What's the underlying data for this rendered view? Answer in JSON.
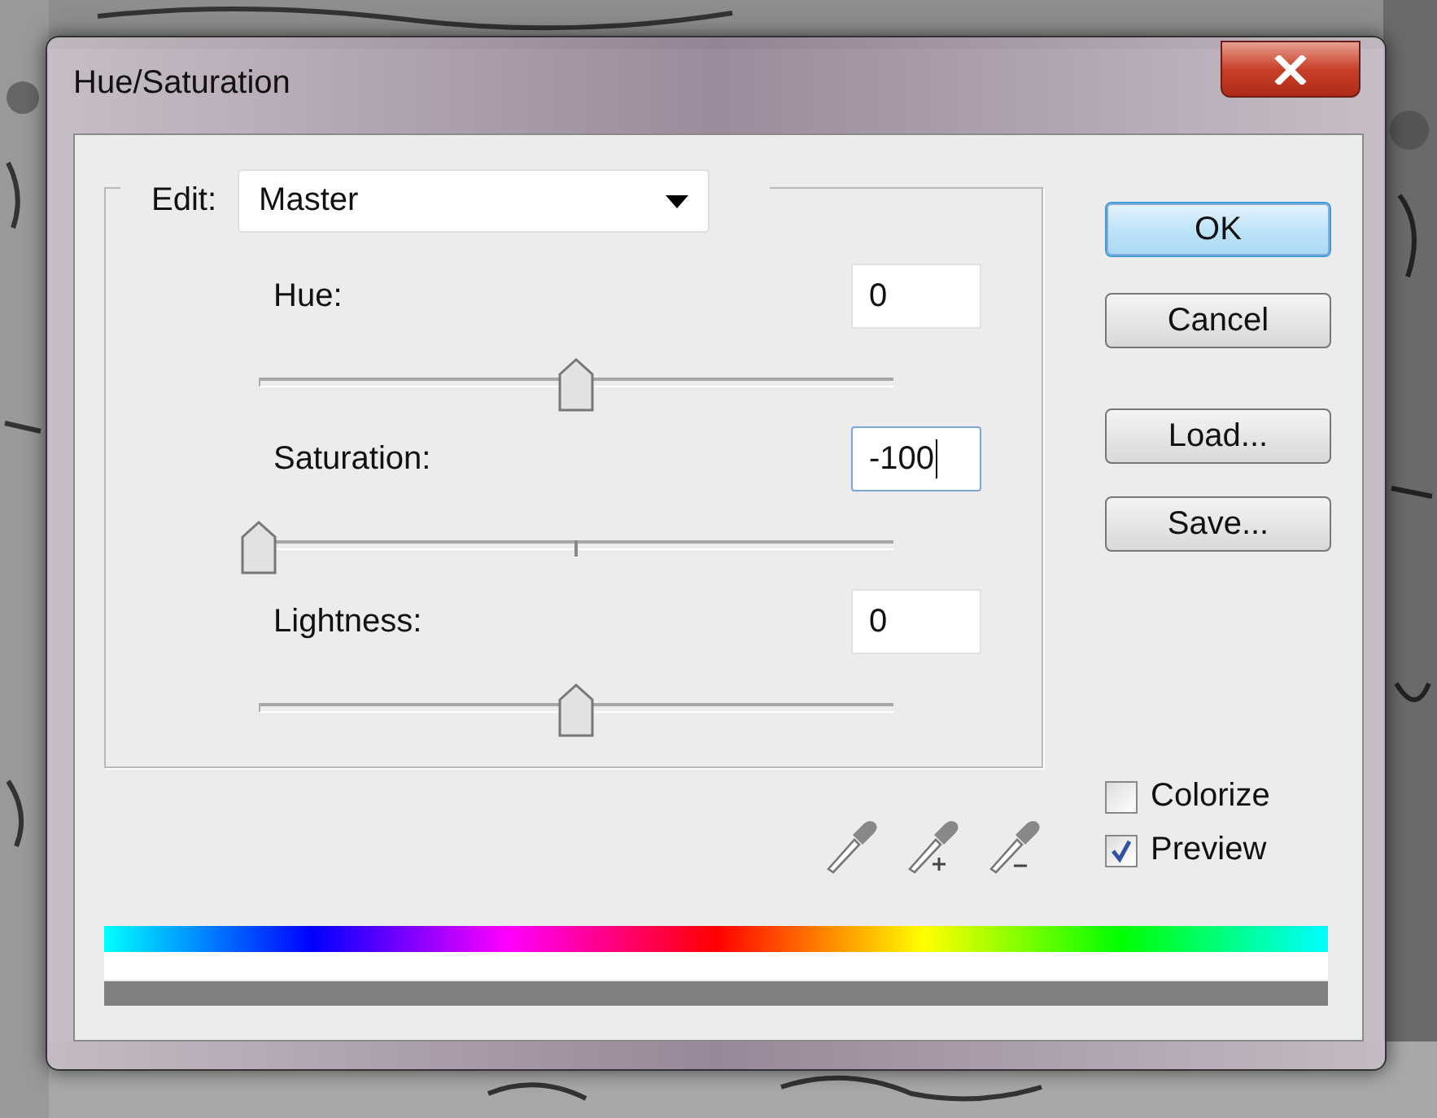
{
  "window": {
    "title": "Hue/Saturation"
  },
  "edit": {
    "label": "Edit:",
    "value": "Master"
  },
  "adjustments": [
    {
      "label": "Hue:",
      "value": "0",
      "level": 0.5,
      "focused": false,
      "center_mark": false
    },
    {
      "label": "Saturation:",
      "value": "-100",
      "level": 0,
      "focused": true,
      "center_mark": true
    },
    {
      "label": "Lightness:",
      "value": "0",
      "level": 0.5,
      "focused": false,
      "center_mark": false
    }
  ],
  "buttons": [
    {
      "label": "OK",
      "default": true
    },
    {
      "label": "Cancel",
      "default": false
    },
    {
      "label": "Load...",
      "default": false
    },
    {
      "label": "Save...",
      "default": false
    }
  ],
  "options": [
    {
      "label": "Colorize",
      "checked": false
    },
    {
      "label": "Preview",
      "checked": true
    }
  ]
}
